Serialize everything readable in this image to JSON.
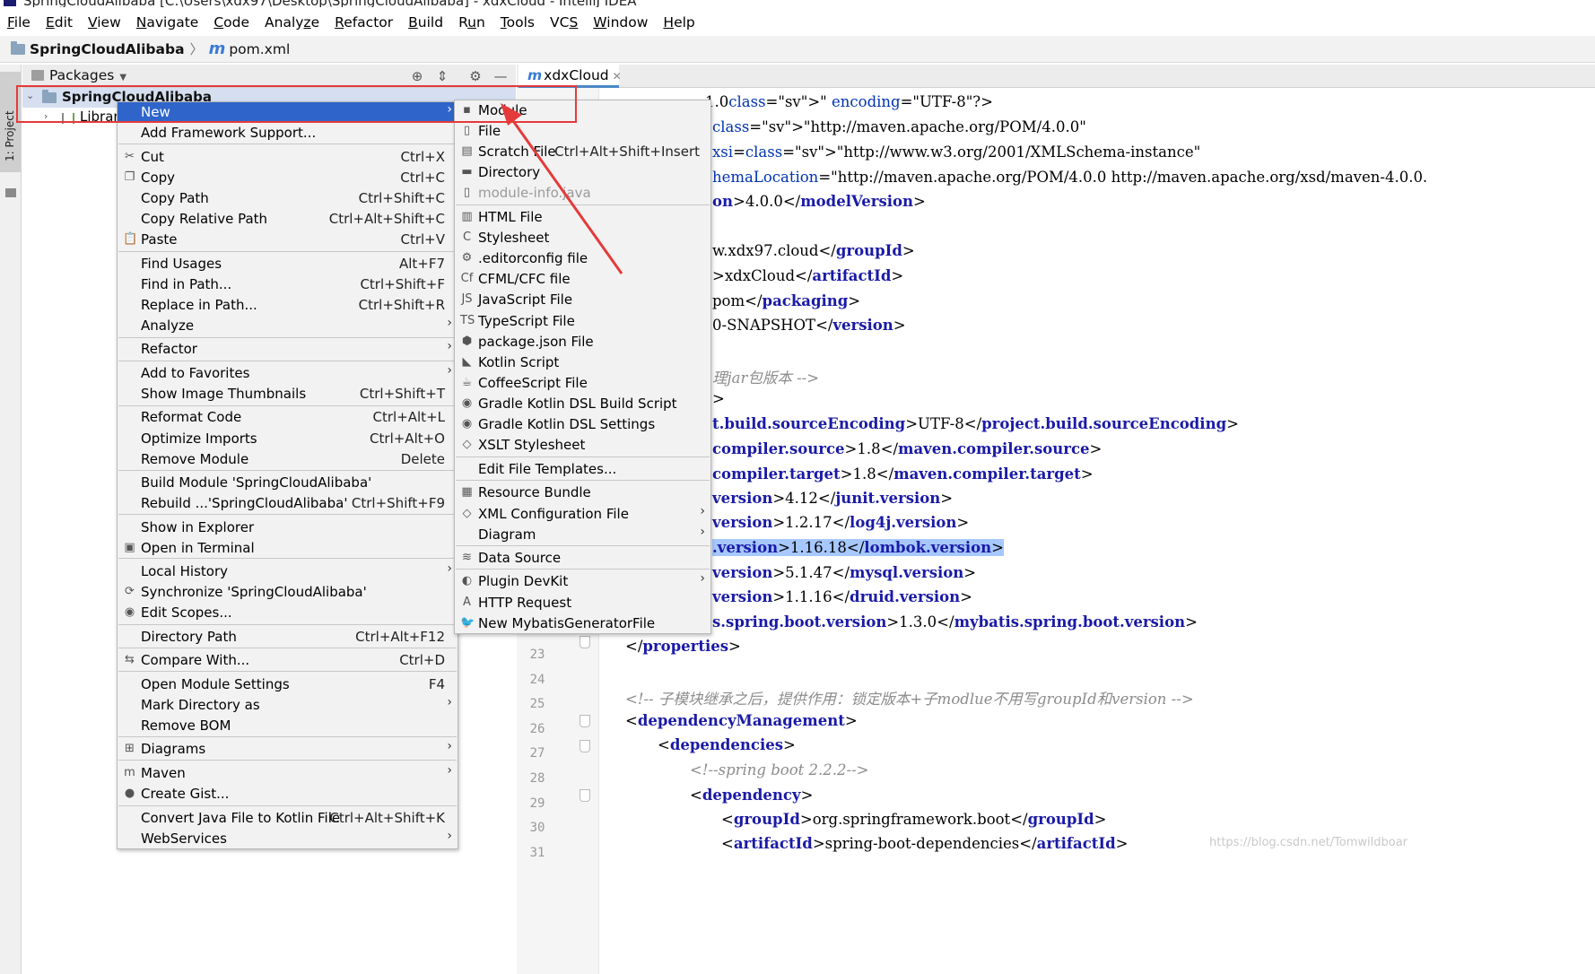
{
  "window": {
    "title": "SpringCloudAlibaba [C:\\Users\\xdx97\\Desktop\\SpringCloudAlibaba] - xdxCloud - IntelliJ IDEA"
  },
  "menubar": [
    {
      "pre": "",
      "u": "F",
      "post": "ile"
    },
    {
      "pre": "",
      "u": "E",
      "post": "dit"
    },
    {
      "pre": "",
      "u": "V",
      "post": "iew"
    },
    {
      "pre": "",
      "u": "N",
      "post": "avigate"
    },
    {
      "pre": "",
      "u": "C",
      "post": "ode"
    },
    {
      "pre": "Analy",
      "u": "z",
      "post": "e"
    },
    {
      "pre": "",
      "u": "R",
      "post": "efactor"
    },
    {
      "pre": "",
      "u": "B",
      "post": "uild"
    },
    {
      "pre": "R",
      "u": "u",
      "post": "n"
    },
    {
      "pre": "",
      "u": "T",
      "post": "ools"
    },
    {
      "pre": "VC",
      "u": "S",
      "post": ""
    },
    {
      "pre": "",
      "u": "W",
      "post": "indow"
    },
    {
      "pre": "",
      "u": "H",
      "post": "elp"
    }
  ],
  "navbar": {
    "project": "SpringCloudAlibaba",
    "file": "pom.xml"
  },
  "left_stripe": {
    "tab_label": "1: Project"
  },
  "project_panel": {
    "view_selector": "Packages",
    "root_label": "SpringCloudAlibaba",
    "child_label": "Librari"
  },
  "editor": {
    "tab_label": "xdxCloud",
    "line_numbers": [
      "23",
      "24",
      "25",
      "26",
      "27",
      "28",
      "29",
      "30",
      "31"
    ]
  },
  "code": [
    "1.0\" encoding=\"UTF-8\"?>",
    "\"http://maven.apache.org/POM/4.0.0\"",
    "xsi=\"http://www.w3.org/2001/XMLSchema-instance\"",
    "hemaLocation=\"http://maven.apache.org/POM/4.0.0 http://maven.apache.org/xsd/maven-4.0.0.",
    "on>4.0.0</modelVersion>",
    "w.xdx97.cloud</groupId>",
    ">xdxCloud</artifactId>",
    "pom</packaging>",
    "0-SNAPSHOT</version>",
    "理jar包版本 -->",
    ">",
    "t.build.sourceEncoding>UTF-8</project.build.sourceEncoding>",
    "compiler.source>1.8</maven.compiler.source>",
    "compiler.target>1.8</maven.compiler.target>",
    "version>4.12</junit.version>",
    "version>1.2.17</log4j.version>",
    ".version>1.16.18</lombok.version>",
    "version>5.1.47</mysql.version>",
    "version>1.1.16</druid.version>",
    "s.spring.boot.version>1.3.0</mybatis.spring.boot.version>",
    "</properties>",
    "<!-- 子模块继承之后，提供作用：锁定版本+子modlue不用写groupId和version  -->",
    "<dependencyManagement>",
    "<dependencies>",
    "<!--spring boot 2.2.2-->",
    "<dependency>",
    "<groupId>org.springframework.boot</groupId>",
    "<artifactId>spring-boot-dependencies</artifactId>"
  ],
  "context_menu": {
    "items": [
      {
        "label": "New",
        "shortcut": "",
        "icon": "",
        "submenu": true,
        "active": true
      },
      {
        "label": "Add Framework Support...",
        "shortcut": "",
        "icon": ""
      },
      {
        "label": "Cut",
        "shortcut": "Ctrl+X",
        "icon": "scissors-icon"
      },
      {
        "label": "Copy",
        "shortcut": "Ctrl+C",
        "icon": "copy-icon"
      },
      {
        "label": "Copy Path",
        "shortcut": "Ctrl+Shift+C",
        "icon": ""
      },
      {
        "label": "Copy Relative Path",
        "shortcut": "Ctrl+Alt+Shift+C",
        "icon": ""
      },
      {
        "label": "Paste",
        "shortcut": "Ctrl+V",
        "icon": "paste-icon"
      },
      {
        "label": "Find Usages",
        "shortcut": "Alt+F7",
        "icon": ""
      },
      {
        "label": "Find in Path...",
        "shortcut": "Ctrl+Shift+F",
        "icon": ""
      },
      {
        "label": "Replace in Path...",
        "shortcut": "Ctrl+Shift+R",
        "icon": ""
      },
      {
        "label": "Analyze",
        "shortcut": "",
        "icon": "",
        "submenu": true
      },
      {
        "label": "Refactor",
        "shortcut": "",
        "icon": "",
        "submenu": true
      },
      {
        "label": "Add to Favorites",
        "shortcut": "",
        "icon": "",
        "submenu": true
      },
      {
        "label": "Show Image Thumbnails",
        "shortcut": "Ctrl+Shift+T",
        "icon": ""
      },
      {
        "label": "Reformat Code",
        "shortcut": "Ctrl+Alt+L",
        "icon": ""
      },
      {
        "label": "Optimize Imports",
        "shortcut": "Ctrl+Alt+O",
        "icon": ""
      },
      {
        "label": "Remove Module",
        "shortcut": "Delete",
        "icon": ""
      },
      {
        "label": "Build Module 'SpringCloudAlibaba'",
        "shortcut": "",
        "icon": ""
      },
      {
        "label": "Rebuild ...'SpringCloudAlibaba'",
        "shortcut": "Ctrl+Shift+F9",
        "icon": ""
      },
      {
        "label": "Show in Explorer",
        "shortcut": "",
        "icon": ""
      },
      {
        "label": "Open in Terminal",
        "shortcut": "",
        "icon": "terminal-icon"
      },
      {
        "label": "Local History",
        "shortcut": "",
        "icon": "",
        "submenu": true
      },
      {
        "label": "Synchronize 'SpringCloudAlibaba'",
        "shortcut": "",
        "icon": "sync-icon"
      },
      {
        "label": "Edit Scopes...",
        "shortcut": "",
        "icon": "scope-icon"
      },
      {
        "label": "Directory Path",
        "shortcut": "Ctrl+Alt+F12",
        "icon": ""
      },
      {
        "label": "Compare With...",
        "shortcut": "Ctrl+D",
        "icon": "compare-icon"
      },
      {
        "label": "Open Module Settings",
        "shortcut": "F4",
        "icon": ""
      },
      {
        "label": "Mark Directory as",
        "shortcut": "",
        "icon": "",
        "submenu": true
      },
      {
        "label": "Remove BOM",
        "shortcut": "",
        "icon": ""
      },
      {
        "label": "Diagrams",
        "shortcut": "",
        "icon": "diagrams-icon",
        "submenu": true
      },
      {
        "label": "Maven",
        "shortcut": "",
        "icon": "maven-icon",
        "submenu": true
      },
      {
        "label": "Create Gist...",
        "shortcut": "",
        "icon": "github-icon"
      },
      {
        "label": "Convert Java File to Kotlin File",
        "shortcut": "Ctrl+Alt+Shift+K",
        "icon": ""
      },
      {
        "label": "WebServices",
        "shortcut": "",
        "icon": "",
        "submenu": true
      }
    ]
  },
  "new_submenu": {
    "items": [
      {
        "label": "Module",
        "shortcut": "",
        "icon": "module-icon"
      },
      {
        "label": "File",
        "shortcut": "",
        "icon": "file-icon"
      },
      {
        "label": "Scratch File",
        "shortcut": "Ctrl+Alt+Shift+Insert",
        "icon": "scratch-file-icon"
      },
      {
        "label": "Directory",
        "shortcut": "",
        "icon": "folder-icon"
      },
      {
        "label": "module-info.java",
        "shortcut": "",
        "icon": "module-info-icon",
        "disabled": true
      },
      {
        "label": "HTML File",
        "shortcut": "",
        "icon": "html-file-icon"
      },
      {
        "label": "Stylesheet",
        "shortcut": "",
        "icon": "css-icon"
      },
      {
        "label": ".editorconfig file",
        "shortcut": "",
        "icon": "editorconfig-icon"
      },
      {
        "label": "CFML/CFC file",
        "shortcut": "",
        "icon": "cfml-icon"
      },
      {
        "label": "JavaScript File",
        "shortcut": "",
        "icon": "javascript-icon"
      },
      {
        "label": "TypeScript File",
        "shortcut": "",
        "icon": "typescript-icon"
      },
      {
        "label": "package.json File",
        "shortcut": "",
        "icon": "nodejs-icon"
      },
      {
        "label": "Kotlin Script",
        "shortcut": "",
        "icon": "kotlin-icon"
      },
      {
        "label": "CoffeeScript File",
        "shortcut": "",
        "icon": "coffeescript-icon"
      },
      {
        "label": "Gradle Kotlin DSL Build Script",
        "shortcut": "",
        "icon": "gradle-icon"
      },
      {
        "label": "Gradle Kotlin DSL Settings",
        "shortcut": "",
        "icon": "gradle-icon"
      },
      {
        "label": "XSLT Stylesheet",
        "shortcut": "",
        "icon": "xslt-icon"
      },
      {
        "label": "Edit File Templates...",
        "shortcut": "",
        "icon": ""
      },
      {
        "label": "Resource Bundle",
        "shortcut": "",
        "icon": "resource-bundle-icon"
      },
      {
        "label": "XML Configuration File",
        "shortcut": "",
        "icon": "xml-icon",
        "submenu": true
      },
      {
        "label": "Diagram",
        "shortcut": "",
        "icon": "",
        "submenu": true
      },
      {
        "label": "Data Source",
        "shortcut": "",
        "icon": "database-icon"
      },
      {
        "label": "Plugin DevKit",
        "shortcut": "",
        "icon": "plugin-icon",
        "submenu": true
      },
      {
        "label": "HTTP Request",
        "shortcut": "",
        "icon": "api-icon"
      },
      {
        "label": "New MybatisGeneratorFile",
        "shortcut": "",
        "icon": "mybatis-bird-icon"
      }
    ]
  },
  "watermark": "https://blog.csdn.net/Tomwildboar",
  "colors": {
    "menu_active": "#2f65ca",
    "annotation_red": "#e53a3a",
    "tag": "#1a1aa6",
    "string": "#067d17"
  }
}
